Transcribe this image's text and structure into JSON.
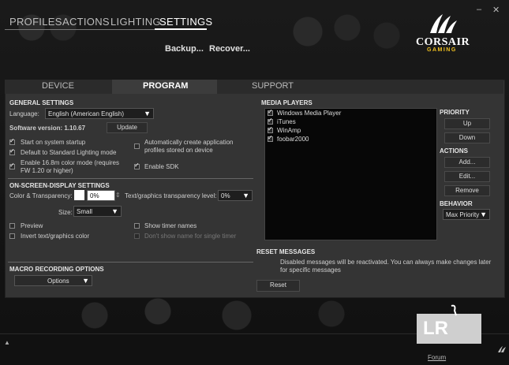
{
  "nav": {
    "items": [
      "PROFILES",
      "ACTIONS",
      "LIGHTING",
      "SETTINGS"
    ],
    "active": "SETTINGS"
  },
  "subnav": {
    "backup": "Backup...",
    "recover": "Recover..."
  },
  "brand": {
    "name": "CORSAIR",
    "sub": "GAMING"
  },
  "window": {
    "minimize": "–",
    "close": "✕"
  },
  "tabs": [
    "DEVICE",
    "PROGRAM",
    "SUPPORT"
  ],
  "general": {
    "title": "GENERAL SETTINGS",
    "language_label": "Language:",
    "language_value": "English (American English)",
    "version_label": "Software version: 1.10.67",
    "update_button": "Update",
    "options": [
      {
        "label": "Start on system startup",
        "checked": true
      },
      {
        "label": "Default to Standard Lighting mode",
        "checked": true
      },
      {
        "label": "Enable 16.8m color mode (requires",
        "label2": "FW 1.20 or higher)",
        "checked": true
      },
      {
        "label": "Automatically create application",
        "label2": "profiles stored on device",
        "checked": false
      },
      {
        "label": "Enable SDK",
        "checked": true
      }
    ]
  },
  "osd": {
    "title": "ON-SCREEN-DISPLAY SETTINGS",
    "color_label": "Color & Transparency:",
    "transparency_value": "0%",
    "text_transparency_label": "Text/graphics transparency level:",
    "text_transparency_value": "0%",
    "size_label": "Size:",
    "size_value": "Small",
    "preview": "Preview",
    "invert": "Invert text/graphics color",
    "show_timer": "Show timer names",
    "dont_show": "Don't show name for single timer"
  },
  "macro": {
    "title": "MACRO RECORDING OPTIONS",
    "options_button": "Options"
  },
  "media": {
    "title": "MEDIA PLAYERS",
    "players": [
      "Windows Media Player",
      "iTunes",
      "WinAmp",
      "foobar2000"
    ]
  },
  "priority": {
    "title": "PRIORITY",
    "up": "Up",
    "down": "Down"
  },
  "actions": {
    "title": "ACTIONS",
    "add": "Add...",
    "edit": "Edit...",
    "remove": "Remove"
  },
  "behavior": {
    "title": "BEHAVIOR",
    "value": "Max Priority"
  },
  "reset": {
    "title": "RESET MESSAGES",
    "text1": "Disabled messages will be reactivated. You can always make changes later",
    "text2": "for specific messages",
    "button": "Reset"
  },
  "footer": {
    "forum": "Forum",
    "expand": "▲"
  },
  "watermark": {
    "text": "LR"
  }
}
